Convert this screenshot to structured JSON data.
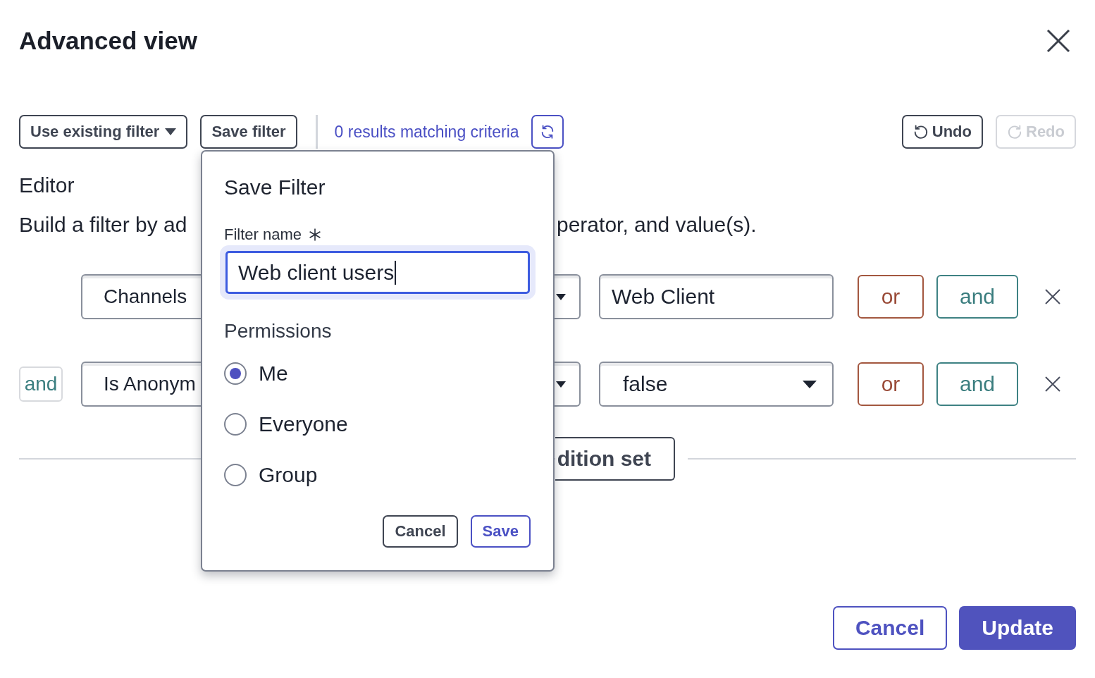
{
  "dialog": {
    "title": "Advanced view"
  },
  "toolbar": {
    "use_existing_filter": {
      "label": "Use existing filter"
    },
    "save_filter": {
      "label": "Save filter"
    },
    "results": "0 results matching criteria",
    "history": [
      {
        "kind": "undo",
        "label": "Undo",
        "disabled": false
      },
      {
        "kind": "redo",
        "label": "Redo",
        "disabled": true
      }
    ]
  },
  "editor": {
    "heading": "Editor",
    "description_start": "Build a filter by ad",
    "description_end": "perator, and value(s).",
    "conditions": [
      {
        "field": "Channels",
        "value": {
          "kind": "text",
          "text": "Web Client"
        },
        "buttons": [
          {
            "kind": "or",
            "label": "or"
          },
          {
            "kind": "and",
            "label": "and"
          }
        ]
      },
      {
        "conjunction": "and",
        "field": "Is Anonym",
        "value": {
          "kind": "select",
          "text": "false"
        },
        "buttons": [
          {
            "kind": "or",
            "label": "or"
          },
          {
            "kind": "and",
            "label": "and"
          }
        ]
      }
    ],
    "add_set_button": "dition set"
  },
  "save_filter_popover": {
    "title": "Save Filter",
    "filter_name": {
      "label": "Filter name",
      "required": true,
      "value": "Web client users",
      "focused": true
    },
    "permissions": {
      "label": "Permissions",
      "options": [
        {
          "label": "Me",
          "selected": true
        },
        {
          "label": "Everyone",
          "selected": false
        },
        {
          "label": "Group",
          "selected": false
        }
      ]
    },
    "buttons": [
      {
        "kind": "neutral",
        "label": "Cancel"
      },
      {
        "kind": "accent",
        "label": "Save"
      }
    ]
  },
  "footer": {
    "buttons": [
      {
        "kind": "outline",
        "label": "Cancel"
      },
      {
        "kind": "filled",
        "label": "Update"
      }
    ]
  }
}
